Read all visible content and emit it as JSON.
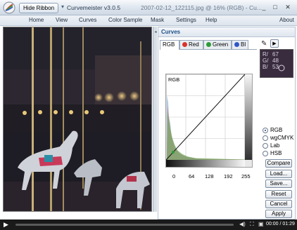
{
  "titlebar": {
    "hide_ribbon_label": "Hide Ribbon",
    "separator": "▾",
    "app_title": "Curvemeister v3.0.5",
    "document_title": "2007-02-12_122115.jpg @ 16% (RGB) - Cu...",
    "minimize": "_",
    "maximize": "□",
    "close": "✕"
  },
  "menu": {
    "items": [
      "Home",
      "View",
      "Curves",
      "Color Sample",
      "Mask",
      "Settings",
      "Help"
    ],
    "about": "About"
  },
  "panel": {
    "title": "Curves",
    "tabs": [
      {
        "label": "RGB",
        "color": ""
      },
      {
        "label": "Red",
        "color": "#d9332b"
      },
      {
        "label": "Green",
        "color": "#2e9a3a"
      },
      {
        "label": "Bl",
        "color": "#2f57c8"
      }
    ],
    "readout": {
      "r_label": "R/",
      "r_value": "67",
      "g_label": "G/",
      "g_value": "48",
      "b_label": "B/",
      "b_value": "53"
    },
    "curve_label": "RGB",
    "x_ticks": [
      "0",
      "64",
      "128",
      "192",
      "255"
    ],
    "modes": [
      "RGB",
      "wgCMYK",
      "Lab",
      "HSB"
    ],
    "selected_mode": "RGB",
    "buttons": {
      "compare": "Compare",
      "load": "Load...",
      "save": "Save...",
      "reset": "Reset",
      "cancel": "Cancel",
      "apply": "Apply"
    }
  },
  "player": {
    "time": "00:00 / 01:29",
    "progress": 0.0
  },
  "colors": {
    "title_accent": "#1d4f86",
    "swatch": "#3a2c3f"
  }
}
